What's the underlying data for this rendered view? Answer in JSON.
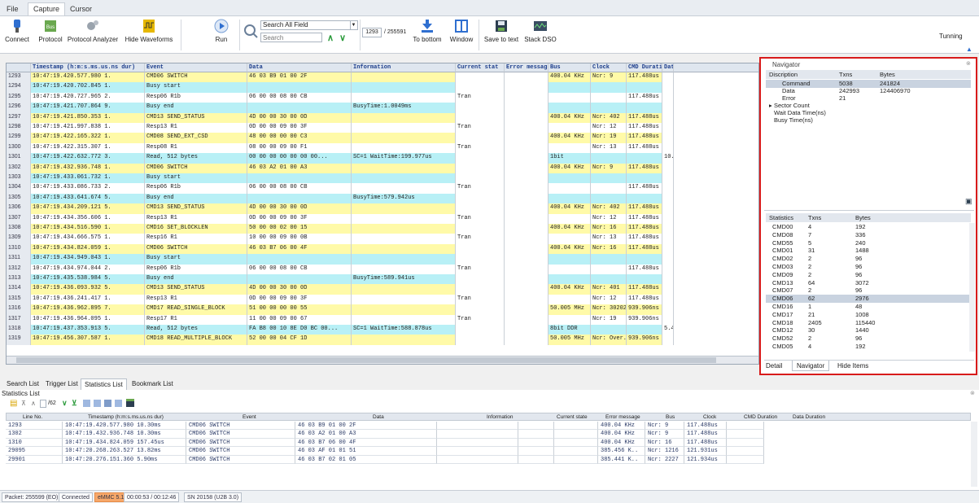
{
  "menu_tabs": [
    "File",
    "Capture",
    "Cursor"
  ],
  "ribbon": {
    "connect": "Connect",
    "protocol": "Protocol",
    "protocol_analyzer": "Protocol Analyzer",
    "hide_waveforms": "Hide Waveforms",
    "run": "Run",
    "search_field": "Search All Field",
    "search_placeholder": "Search",
    "page_current": "1293",
    "page_total": "/ 255591",
    "to_bottom": "To bottom",
    "window": "Window",
    "save_to_text": "Save to text",
    "stack_dso": "Stack DSO",
    "mode": "Tunning"
  },
  "main_table": {
    "headers": [
      "Timestamp (h:m:s.ms.us.ns dur)",
      "Event",
      "Data",
      "Information",
      "Current stat",
      "Error messag",
      "Bus",
      "Clock",
      "CMD Duratic",
      "Dat"
    ],
    "rows": [
      {
        "n": "1293",
        "ts": "10:47:19.420.577.980 1.",
        "ev": "CMD06 SWITCH",
        "data": "46 03 B9 01 00 2F",
        "info": "",
        "cur": "",
        "bus": "400.04 KHz",
        "clk": "Ncr: 9",
        "dur": "117.488us",
        "dat": "",
        "c": "c-yellow"
      },
      {
        "n": "1294",
        "ts": "10:47:19.420.702.845 1.",
        "ev": "    Busy start",
        "data": "",
        "info": "",
        "cur": "",
        "bus": "",
        "clk": "",
        "dur": "",
        "dat": "",
        "c": "c-cyan"
      },
      {
        "n": "1295",
        "ts": "10:47:19.420.727.965 2.",
        "ev": "  Resp06 R1b",
        "data": "06 00 00 08 00 CB",
        "info": "",
        "cur": "Tran",
        "bus": "",
        "clk": "",
        "dur": "117.488us",
        "dat": "",
        "c": "c-white"
      },
      {
        "n": "1296",
        "ts": "10:47:19.421.707.864 9.",
        "ev": "    Busy end",
        "data": "",
        "info": "BusyTime:1.0049ms",
        "cur": "",
        "bus": "",
        "clk": "",
        "dur": "",
        "dat": "",
        "c": "c-cyan"
      },
      {
        "n": "1297",
        "ts": "10:47:19.421.850.353 1.",
        "ev": "CMD13 SEND_STATUS",
        "data": "4D 00 00 30 00 0D",
        "info": "",
        "cur": "",
        "bus": "400.04 KHz",
        "clk": "Ncr: 402",
        "dur": "117.488us",
        "dat": "",
        "c": "c-yellow"
      },
      {
        "n": "1298",
        "ts": "10:47:19.421.997.838 1.",
        "ev": "  Resp13 R1",
        "data": "0D 00 00 09 00 3F",
        "info": "",
        "cur": "Tran",
        "bus": "",
        "clk": "Ncr: 12",
        "dur": "117.488us",
        "dat": "",
        "c": "c-white"
      },
      {
        "n": "1299",
        "ts": "10:47:19.422.165.322 1.",
        "ev": "CMD08 SEND_EXT_CSD",
        "data": "48 00 00 00 00 C3",
        "info": "",
        "cur": "",
        "bus": "400.04 KHz",
        "clk": "Ncr: 19",
        "dur": "117.488us",
        "dat": "",
        "c": "c-yellow"
      },
      {
        "n": "1300",
        "ts": "10:47:19.422.315.307 1.",
        "ev": "  Resp08 R1",
        "data": "08 00 00 09 00 F1",
        "info": "",
        "cur": "Tran",
        "bus": "",
        "clk": "Ncr: 13",
        "dur": "117.488us",
        "dat": "",
        "c": "c-white"
      },
      {
        "n": "1301",
        "ts": "10:47:19.422.632.772 3.",
        "ev": "    Read,  512 bytes",
        "data": "00 00 00 00 00 00 00...",
        "info": "SC=1 WaitTime:199.977us",
        "cur": "",
        "bus": "1bit",
        "clk": "",
        "dur": "",
        "dat": "10.",
        "c": "c-cyan"
      },
      {
        "n": "1302",
        "ts": "10:47:19.432.936.748 1.",
        "ev": "CMD06 SWITCH",
        "data": "46 03 A2 01 00 A3",
        "info": "",
        "cur": "",
        "bus": "400.04 KHz",
        "clk": "Ncr: 9",
        "dur": "117.488us",
        "dat": "",
        "c": "c-yellow"
      },
      {
        "n": "1303",
        "ts": "10:47:19.433.061.732 1.",
        "ev": "    Busy start",
        "data": "",
        "info": "",
        "cur": "",
        "bus": "",
        "clk": "",
        "dur": "",
        "dat": "",
        "c": "c-cyan"
      },
      {
        "n": "1304",
        "ts": "10:47:19.433.086.733 2.",
        "ev": "  Resp06 R1b",
        "data": "06 00 00 08 00 CB",
        "info": "",
        "cur": "Tran",
        "bus": "",
        "clk": "",
        "dur": "117.488us",
        "dat": "",
        "c": "c-white"
      },
      {
        "n": "1305",
        "ts": "10:47:19.433.641.674 5.",
        "ev": "    Busy end",
        "data": "",
        "info": "BusyTime:579.942us",
        "cur": "",
        "bus": "",
        "clk": "",
        "dur": "",
        "dat": "",
        "c": "c-cyan"
      },
      {
        "n": "1306",
        "ts": "10:47:19.434.209.121 5.",
        "ev": "CMD13 SEND_STATUS",
        "data": "4D 00 00 30 00 0D",
        "info": "",
        "cur": "",
        "bus": "400.04 KHz",
        "clk": "Ncr: 402",
        "dur": "117.488us",
        "dat": "",
        "c": "c-yellow"
      },
      {
        "n": "1307",
        "ts": "10:47:19.434.356.606 1.",
        "ev": "  Resp13 R1",
        "data": "0D 00 00 09 00 3F",
        "info": "",
        "cur": "Tran",
        "bus": "",
        "clk": "Ncr: 12",
        "dur": "117.488us",
        "dat": "",
        "c": "c-white"
      },
      {
        "n": "1308",
        "ts": "10:47:19.434.516.590 1.",
        "ev": "CMD16 SET_BLOCKLEN",
        "data": "50 00 00 02 00 15",
        "info": "",
        "cur": "",
        "bus": "400.04 KHz",
        "clk": "Ncr: 16",
        "dur": "117.488us",
        "dat": "",
        "c": "c-yellow"
      },
      {
        "n": "1309",
        "ts": "10:47:19.434.666.575 1.",
        "ev": "  Resp16 R1",
        "data": "10 00 00 09 00 0B",
        "info": "",
        "cur": "Tran",
        "bus": "",
        "clk": "Ncr: 13",
        "dur": "117.488us",
        "dat": "",
        "c": "c-white"
      },
      {
        "n": "1310",
        "ts": "10:47:19.434.824.059 1.",
        "ev": "CMD06 SWITCH",
        "data": "46 03 B7 06 00 4F",
        "info": "",
        "cur": "",
        "bus": "400.04 KHz",
        "clk": "Ncr: 16",
        "dur": "117.488us",
        "dat": "",
        "c": "c-yellow"
      },
      {
        "n": "1311",
        "ts": "10:47:19.434.949.043 1.",
        "ev": "    Busy start",
        "data": "",
        "info": "",
        "cur": "",
        "bus": "",
        "clk": "",
        "dur": "",
        "dat": "",
        "c": "c-cyan"
      },
      {
        "n": "1312",
        "ts": "10:47:19.434.974.044 2.",
        "ev": "  Resp06 R1b",
        "data": "06 00 00 08 00 CB",
        "info": "",
        "cur": "Tran",
        "bus": "",
        "clk": "",
        "dur": "117.488us",
        "dat": "",
        "c": "c-white"
      },
      {
        "n": "1313",
        "ts": "10:47:19.435.538.984 5.",
        "ev": "    Busy end",
        "data": "",
        "info": "BusyTime:589.941us",
        "cur": "",
        "bus": "",
        "clk": "",
        "dur": "",
        "dat": "",
        "c": "c-cyan"
      },
      {
        "n": "1314",
        "ts": "10:47:19.436.093.932 5.",
        "ev": "CMD13 SEND_STATUS",
        "data": "4D 00 00 30 00 0D",
        "info": "",
        "cur": "",
        "bus": "400.04 KHz",
        "clk": "Ncr: 401",
        "dur": "117.488us",
        "dat": "",
        "c": "c-yellow"
      },
      {
        "n": "1315",
        "ts": "10:47:19.436.241.417 1.",
        "ev": "  Resp13 R1",
        "data": "0D 00 00 09 00 3F",
        "info": "",
        "cur": "Tran",
        "bus": "",
        "clk": "Ncr: 12",
        "dur": "117.488us",
        "dat": "",
        "c": "c-white"
      },
      {
        "n": "1316",
        "ts": "10:47:19.436.962.895 7.",
        "ev": "CMD17 READ_SINGLE_BLOCK",
        "data": "51 00 00 00 00 55",
        "info": "",
        "cur": "",
        "bus": "50.005 MHz",
        "clk": "Ncr: 30202",
        "dur": "939.906ns",
        "dat": "",
        "c": "c-yellow"
      },
      {
        "n": "1317",
        "ts": "10:47:19.436.964.095 1.",
        "ev": "  Resp17 R1",
        "data": "11 00 00 09 00 67",
        "info": "",
        "cur": "Tran",
        "bus": "",
        "clk": "Ncr: 19",
        "dur": "939.906ns",
        "dat": "",
        "c": "c-white"
      },
      {
        "n": "1318",
        "ts": "10:47:19.437.353.913 5.",
        "ev": "    Read,  512 bytes",
        "data": "FA B8 00 10 8E D0 BC 00...",
        "info": "SC=1 WaitTime:588.878us",
        "cur": "",
        "bus": "8bit DDR",
        "clk": "",
        "dur": "",
        "dat": "5.4",
        "c": "c-cyan"
      },
      {
        "n": "1319",
        "ts": "10:47:19.456.307.587 1.",
        "ev": "CMD18 READ_MULTIPLE_BLOCK",
        "data": "52 00 00 04 CF 1D",
        "info": "",
        "cur": "",
        "bus": "50.005 MHz",
        "clk": "Ncr: Over..",
        "dur": "939.906ns",
        "dat": "",
        "c": "c-yellow"
      }
    ]
  },
  "navigator": {
    "title": "Navigator",
    "headers": [
      "Discription",
      "Txns",
      "Bytes"
    ],
    "items": [
      {
        "name": "Command",
        "txns": "5038",
        "bytes": "241824"
      },
      {
        "name": "Data",
        "txns": "242993",
        "bytes": "124406970"
      },
      {
        "name": "Error",
        "txns": "21",
        "bytes": ""
      },
      {
        "name": "Sector Count",
        "txns": "",
        "bytes": ""
      },
      {
        "name": "Wait Data Time(ns)",
        "txns": "",
        "bytes": ""
      },
      {
        "name": "Busy Time(ns)",
        "txns": "",
        "bytes": ""
      }
    ]
  },
  "statistics": {
    "headers": [
      "Statistics",
      "Txns",
      "Bytes"
    ],
    "items": [
      {
        "name": "CMD00",
        "txns": "4",
        "bytes": "192"
      },
      {
        "name": "CMD08",
        "txns": "7",
        "bytes": "336"
      },
      {
        "name": "CMD55",
        "txns": "5",
        "bytes": "240"
      },
      {
        "name": "CMD01",
        "txns": "31",
        "bytes": "1488"
      },
      {
        "name": "CMD02",
        "txns": "2",
        "bytes": "96"
      },
      {
        "name": "CMD03",
        "txns": "2",
        "bytes": "96"
      },
      {
        "name": "CMD09",
        "txns": "2",
        "bytes": "96"
      },
      {
        "name": "CMD13",
        "txns": "64",
        "bytes": "3072"
      },
      {
        "name": "CMD07",
        "txns": "2",
        "bytes": "96"
      },
      {
        "name": "CMD06",
        "txns": "62",
        "bytes": "2976"
      },
      {
        "name": "CMD16",
        "txns": "1",
        "bytes": "48"
      },
      {
        "name": "CMD17",
        "txns": "21",
        "bytes": "1008"
      },
      {
        "name": "CMD18",
        "txns": "2405",
        "bytes": "115440"
      },
      {
        "name": "CMD12",
        "txns": "30",
        "bytes": "1440"
      },
      {
        "name": "CMD52",
        "txns": "2",
        "bytes": "96"
      },
      {
        "name": "CMD05",
        "txns": "4",
        "bytes": "192"
      }
    ],
    "selected": "CMD06"
  },
  "right_tabs": [
    "Detail",
    "Navigator",
    "Hide Items"
  ],
  "bottom_tabs": [
    "Search List",
    "Trigger List",
    "Statistics List",
    "Bookmark List"
  ],
  "stats_list": {
    "title": "Statistics List",
    "page": "/62",
    "headers": [
      "Line No.",
      "Timestamp (h:m:s.ms.us.ns dur)",
      "Event",
      "Data",
      "Information",
      "Current state",
      "Error message",
      "Bus",
      "Clock",
      "CMD Duration",
      "Data Duration"
    ],
    "rows": [
      {
        "n": "1293",
        "ts": "10:47:19.420.577.980 10.30ms",
        "ev": "CMD06 SWITCH",
        "data": "46 03 B9 01 00 2F",
        "bus": "400.04 KHz",
        "clk": "Ncr: 9",
        "dur": "117.488us"
      },
      {
        "n": "1302",
        "ts": "10:47:19.432.936.748 10.30ms",
        "ev": "CMD06 SWITCH",
        "data": "46 03 A2 01 00 A3",
        "bus": "400.04 KHz",
        "clk": "Ncr: 9",
        "dur": "117.488us"
      },
      {
        "n": "1310",
        "ts": "10:47:19.434.824.059 157.45us",
        "ev": "CMD06 SWITCH",
        "data": "46 03 B7 06 00 4F",
        "bus": "400.04 KHz",
        "clk": "Ncr: 16",
        "dur": "117.488us"
      },
      {
        "n": "29095",
        "ts": "10:47:20.268.263.527 13.82ms",
        "ev": "CMD06 SWITCH",
        "data": "46 03 AF 01 01 51",
        "bus": "385.456 K..",
        "clk": "Ncr: 1216",
        "dur": "121.931us"
      },
      {
        "n": "29901",
        "ts": "10:47:20.276.151.360 5.90ms",
        "ev": "CMD06 SWITCH",
        "data": "46 03 B7 02 01 05",
        "bus": "385.441 K..",
        "clk": "Ncr: 2227",
        "dur": "121.934us"
      }
    ]
  },
  "status_bar": [
    "Packet: 255599 (EO)",
    "Connected",
    "eMMC 5.1",
    "00:00:53 / 00:12:46",
    "SN 20158 (U2B 3.0)"
  ],
  "colors": {
    "highlight_box": "#d81b1b",
    "row_yellow": "#fffaa8",
    "row_cyan": "#b8f0f6",
    "status_orange": "#f7a86a"
  }
}
